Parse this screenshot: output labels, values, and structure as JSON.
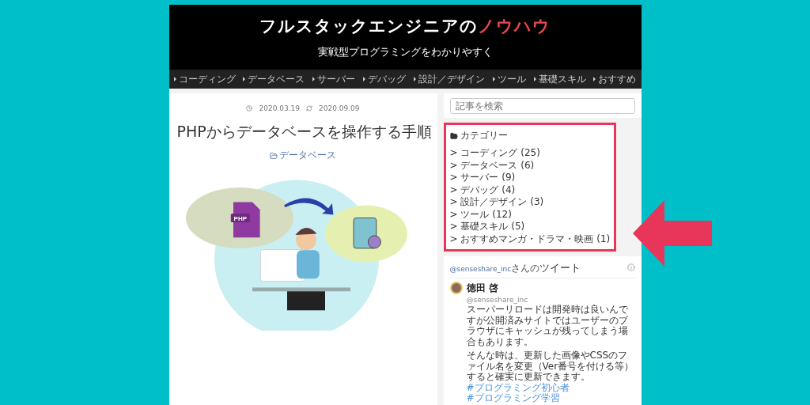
{
  "header": {
    "title": "フルスタックエンジニアの",
    "title_accent": "ノウハウ",
    "tagline": "実戦型プログラミングをわかりやすく"
  },
  "nav": [
    "コーディング",
    "データベース",
    "サーバー",
    "デバッグ",
    "設計／デザイン",
    "ツール",
    "基礎スキル",
    "おすすめ"
  ],
  "article": {
    "published": "2020.03.19",
    "updated": "2020.09.09",
    "title": "PHPからデータベースを操作する手順",
    "category": "データベース",
    "illustration": {
      "file_label": "PHP"
    }
  },
  "sidebar": {
    "search": {
      "placeholder": "記事を検索"
    },
    "categories": {
      "title": "カテゴリー",
      "highlighted": true,
      "bullet": ">",
      "items": [
        {
          "name": "コーディング",
          "count": "(25)"
        },
        {
          "name": "データベース",
          "count": "(6)"
        },
        {
          "name": "サーバー",
          "count": "(9)"
        },
        {
          "name": "デバッグ",
          "count": "(4)"
        },
        {
          "name": "設計／デザイン",
          "count": "(3)"
        },
        {
          "name": "ツール",
          "count": "(12)"
        },
        {
          "name": "基礎スキル",
          "count": "(5)"
        },
        {
          "name": "おすすめマンガ・ドラマ・映画",
          "count": "(1)"
        }
      ]
    },
    "tweets": {
      "account": "@senseshare_inc",
      "suffix": "さんの",
      "title": "ツイート",
      "items": [
        {
          "name": "徳田 啓",
          "handle": "@senseshare_inc",
          "paragraphs": [
            "スーパーリロードは開発時は良いんですが公開済みサイトではユーザーのブラウザにキャッシュが残ってしまう場合もあります。",
            "そんな時は、更新した画像やCSSのファイル名を変更（Ver番号を付ける等）すると確実に更新できます。"
          ],
          "hashtags": [
            "#プログラミング初心者",
            "#プログラミング学習"
          ]
        }
      ]
    }
  }
}
